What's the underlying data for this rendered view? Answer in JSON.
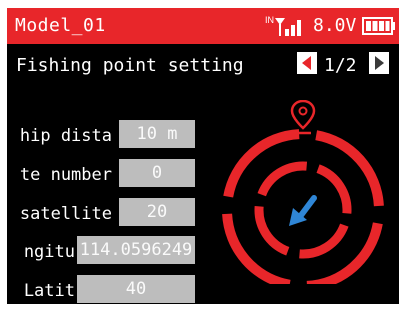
{
  "header": {
    "model": "Model_01",
    "signal_label": "IN",
    "voltage": "8.0V"
  },
  "page": {
    "title": "Fishing point setting",
    "pager": "1/2"
  },
  "rows": [
    {
      "label": "hip dista",
      "value": "10 m"
    },
    {
      "label": "te number",
      "value": "0"
    },
    {
      "label": "satellite",
      "value": "20"
    },
    {
      "label": "ngitu",
      "value": "114.0596249"
    },
    {
      "label": "Latit",
      "value": "40"
    }
  ],
  "colors": {
    "accent": "#e8262a",
    "arrow": "#2f86d6",
    "field": "#bdbdbd"
  },
  "icons": [
    "signal-icon",
    "battery-icon",
    "prev-page-icon",
    "next-page-icon",
    "location-pin-icon",
    "direction-arrow-icon"
  ]
}
